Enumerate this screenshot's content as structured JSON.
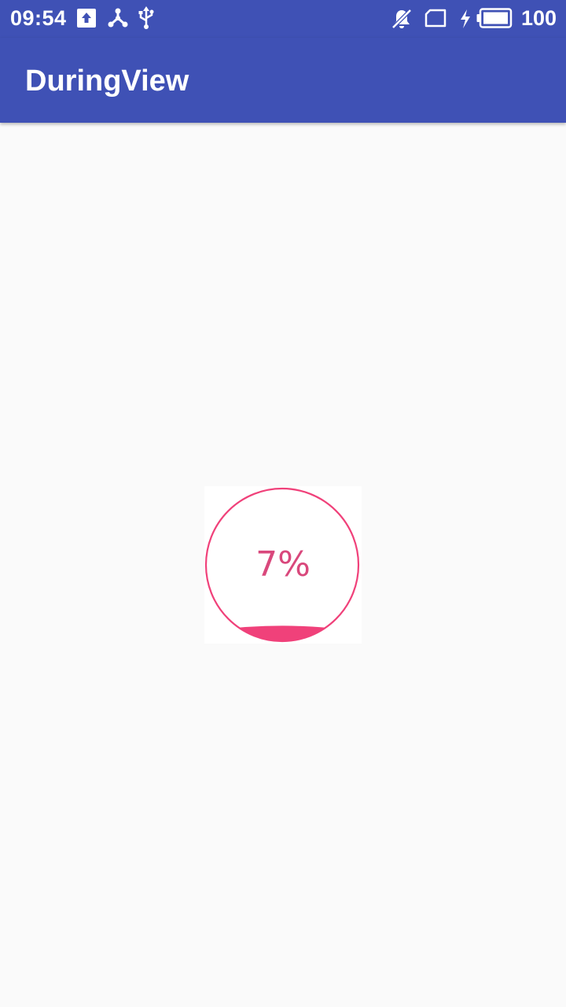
{
  "status_bar": {
    "time": "09:54",
    "battery": "100",
    "background": "#3f51b5",
    "icons": [
      "upload-notification-icon",
      "share-notification-icon",
      "usb-icon",
      "notifications-off-icon",
      "sim-card-icon",
      "charging-icon",
      "battery-full-icon"
    ]
  },
  "app_bar": {
    "title": "DuringView",
    "background": "#3f51b5"
  },
  "during_view": {
    "progress_text": "7%",
    "progress": 0.07,
    "accent_color": "#f0417a",
    "text_color": "#d9487c"
  }
}
